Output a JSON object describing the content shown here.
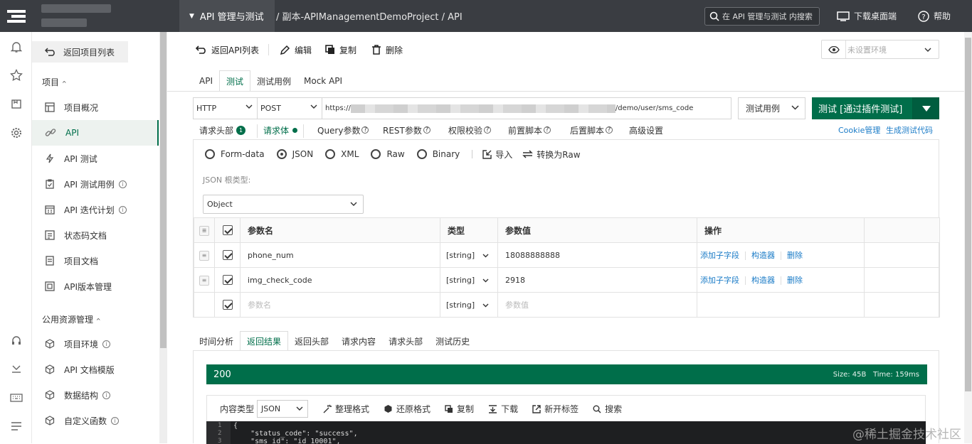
{
  "topbar": {
    "project_menu": "API 管理与测试",
    "breadcrumb": "/ 副本-APIManagementDemoProject / API",
    "search_placeholder": "在 API 管理与测试 内搜索",
    "download": "下载桌面端",
    "help": "帮助"
  },
  "sidebar": {
    "back": "返回项目列表",
    "section_project": "项目",
    "items": [
      {
        "label": "项目概况",
        "icon": "dashboard-icon"
      },
      {
        "label": "API",
        "icon": "link-icon",
        "active": true
      },
      {
        "label": "API 测试",
        "icon": "bolt-icon"
      },
      {
        "label": "API 测试用例",
        "icon": "clipboard-icon",
        "info": true
      },
      {
        "label": "API 迭代计划",
        "icon": "calendar-icon",
        "info": true
      },
      {
        "label": "状态码文档",
        "icon": "code-doc-icon"
      },
      {
        "label": "项目文档",
        "icon": "document-icon"
      },
      {
        "label": "API版本管理",
        "icon": "version-icon"
      }
    ],
    "section_public": "公用资源管理",
    "public_items": [
      {
        "label": "项目环境",
        "icon": "cube-icon",
        "info": true
      },
      {
        "label": "API 文档模版",
        "icon": "cube-icon"
      },
      {
        "label": "数据结构",
        "icon": "cube-icon",
        "info": true
      },
      {
        "label": "自定义函数",
        "icon": "cube-icon",
        "info": true
      }
    ]
  },
  "toolbar": {
    "back": "返回API列表",
    "edit": "编辑",
    "copy": "复制",
    "delete": "删除",
    "env_placeholder": "未设置环境"
  },
  "tabs": [
    "API",
    "测试",
    "测试用例",
    "Mock API"
  ],
  "active_tab": "测试",
  "request": {
    "protocol": "HTTP",
    "method": "POST",
    "url_prefix": "https://",
    "url_suffix": "/demo/user/sms_code",
    "test_case": "测试用例",
    "run": "测试 [通过插件测试]"
  },
  "subtabs": {
    "items": [
      "请求头部",
      "请求体",
      "Query参数",
      "REST参数",
      "权限校验",
      "前置脚本",
      "后置脚本",
      "高级设置"
    ],
    "header_count": "1",
    "cookie": "Cookie管理",
    "gen_code": "生成测试代码"
  },
  "body": {
    "radios": [
      "Form-data",
      "JSON",
      "XML",
      "Raw",
      "Binary"
    ],
    "selected": "JSON",
    "import": "导入",
    "to_raw": "转换为Raw",
    "root_label": "JSON 根类型:",
    "root_value": "Object"
  },
  "params": {
    "headers": [
      "参数名",
      "类型",
      "参数值",
      "操作"
    ],
    "rows": [
      {
        "name": "phone_num",
        "type": "[string]",
        "value": "18088888888"
      },
      {
        "name": "img_check_code",
        "type": "[string]",
        "value": "2918"
      }
    ],
    "empty_row": {
      "name": "参数名",
      "type": "[string]",
      "value": "参数值"
    },
    "ops": [
      "添加子字段",
      "构造器",
      "删除"
    ]
  },
  "result_tabs": [
    "时间分析",
    "返回结果",
    "返回头部",
    "请求内容",
    "请求头部",
    "测试历史"
  ],
  "active_result_tab": "返回结果",
  "response": {
    "status": "200",
    "size": "Size: 45B",
    "time": "Time: 159ms",
    "content_type_label": "内容类型",
    "content_type": "JSON",
    "actions": [
      "整理格式",
      "还原格式",
      "复制",
      "下载",
      "新开标签",
      "搜索"
    ],
    "code_lines": [
      "{",
      "    \"status_code\": \"success\",",
      "    \"sms_id\": \"id_10001\","
    ]
  },
  "watermark": "@稀土掘金技术社区",
  "colors": {
    "accent": "#006e4a",
    "topbar": "#3a3d42",
    "link": "#1a7bc7"
  }
}
